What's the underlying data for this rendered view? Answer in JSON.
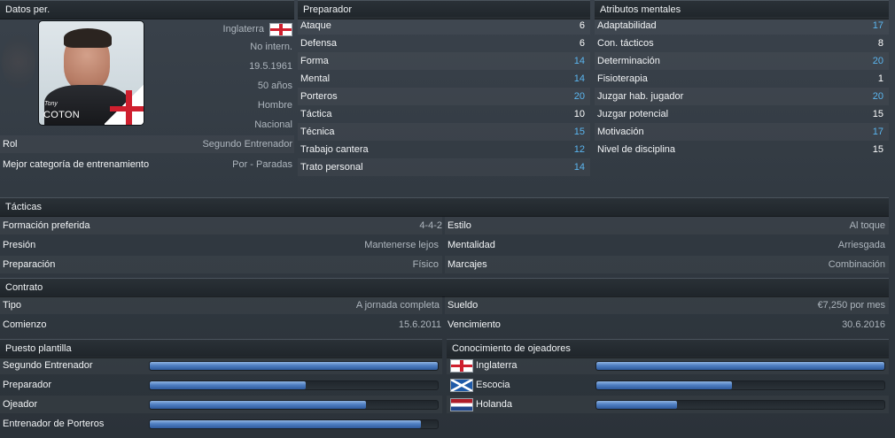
{
  "personal": {
    "header": "Datos per.",
    "photo_first_name": "Tony",
    "photo_last_name": "COTON",
    "rows": [
      {
        "value": "Inglaterra"
      },
      {
        "value": "No intern."
      },
      {
        "value": "19.5.1961"
      },
      {
        "value": "50 años"
      },
      {
        "value": "Hombre"
      },
      {
        "value": "Nacional"
      }
    ],
    "role_label": "Rol",
    "role_value": "Segundo Entrenador",
    "best_label": "Mejor categoría de entrenamiento",
    "best_value": "Por - Paradas"
  },
  "coach": {
    "header": "Preparador",
    "attrs": [
      {
        "label": "Ataque",
        "value": "6",
        "hi": false
      },
      {
        "label": "Defensa",
        "value": "6",
        "hi": false
      },
      {
        "label": "Forma",
        "value": "14",
        "hi": true
      },
      {
        "label": "Mental",
        "value": "14",
        "hi": true
      },
      {
        "label": "Porteros",
        "value": "20",
        "hi": true
      },
      {
        "label": "Táctica",
        "value": "10",
        "hi": false
      },
      {
        "label": "Técnica",
        "value": "15",
        "hi": true
      },
      {
        "label": "Trabajo cantera",
        "value": "12",
        "hi": true
      },
      {
        "label": "Trato personal",
        "value": "14",
        "hi": true
      }
    ]
  },
  "mental": {
    "header": "Atributos mentales",
    "attrs": [
      {
        "label": "Adaptabilidad",
        "value": "17",
        "hi": true
      },
      {
        "label": "Con. tácticos",
        "value": "8",
        "hi": false
      },
      {
        "label": "Determinación",
        "value": "20",
        "hi": true
      },
      {
        "label": "Fisioterapia",
        "value": "1",
        "hi": false
      },
      {
        "label": "Juzgar hab. jugador",
        "value": "20",
        "hi": true
      },
      {
        "label": "Juzgar potencial",
        "value": "15",
        "hi": false
      },
      {
        "label": "Motivación",
        "value": "17",
        "hi": true
      },
      {
        "label": "Nivel de disciplina",
        "value": "15",
        "hi": false
      }
    ]
  },
  "tactics": {
    "header": "Tácticas",
    "left": [
      {
        "label": "Formación preferida",
        "value": "4-4-2"
      },
      {
        "label": "Presión",
        "value": "Mantenerse lejos"
      },
      {
        "label": "Preparación",
        "value": "Físico"
      }
    ],
    "right": [
      {
        "label": "Estilo",
        "value": "Al toque"
      },
      {
        "label": "Mentalidad",
        "value": "Arriesgada"
      },
      {
        "label": "Marcajes",
        "value": "Combinación"
      }
    ]
  },
  "contract": {
    "header": "Contrato",
    "left": [
      {
        "label": "Tipo",
        "value": "A jornada completa"
      },
      {
        "label": "Comienzo",
        "value": "15.6.2011"
      }
    ],
    "right": [
      {
        "label": "Sueldo",
        "value": "€7,250 por mes"
      },
      {
        "label": "Vencimiento",
        "value": "30.6.2016"
      }
    ]
  },
  "staff_role": {
    "header": "Puesto plantilla",
    "items": [
      {
        "label": "Segundo Entrenador",
        "level": 1.0
      },
      {
        "label": "Preparador",
        "level": 0.54
      },
      {
        "label": "Ojeador",
        "level": 0.75
      },
      {
        "label": "Entrenador de Porteros",
        "level": 0.94
      }
    ]
  },
  "scout": {
    "header": "Conocimiento de ojeadores",
    "items": [
      {
        "label": "Inglaterra",
        "flag": "england-flag-icon",
        "level": 1.0
      },
      {
        "label": "Escocia",
        "flag": "scotland-flag-icon",
        "level": 0.47
      },
      {
        "label": "Holanda",
        "flag": "netherlands-flag-icon",
        "level": 0.28
      }
    ]
  },
  "colors": {
    "highlight": "#5bb6f0",
    "bar_fill": "#4f7fc2",
    "header_bg": "#1f252a"
  }
}
